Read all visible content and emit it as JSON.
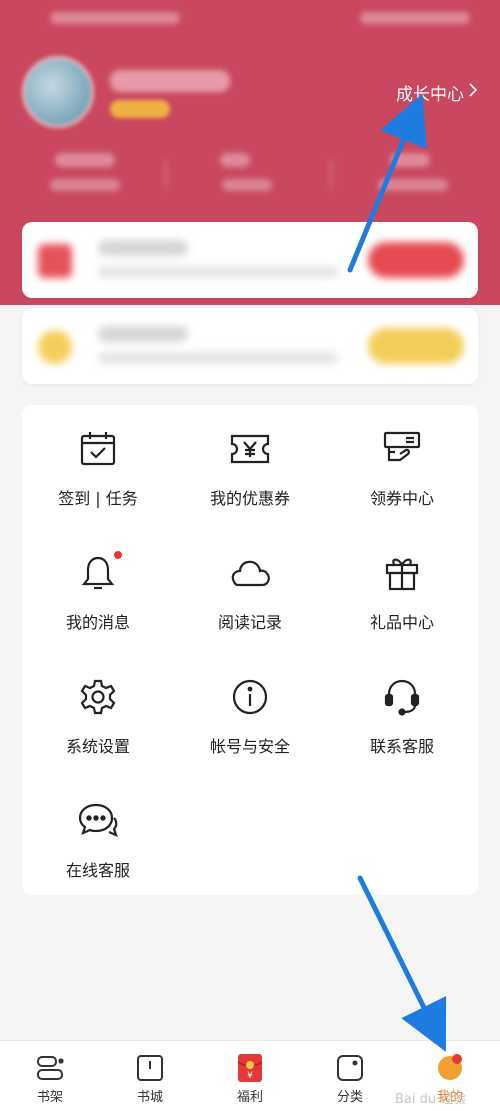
{
  "header": {
    "growth_center": "成长中心",
    "accent_color": "#c9485f"
  },
  "menu": {
    "items": [
      {
        "label": "签到 | 任务",
        "icon": "calendar-check-icon"
      },
      {
        "label": "我的优惠券",
        "icon": "yen-coupon-icon"
      },
      {
        "label": "领券中心",
        "icon": "coupon-hand-icon"
      },
      {
        "label": "我的消息",
        "icon": "bell-icon",
        "badge": true
      },
      {
        "label": "阅读记录",
        "icon": "cloud-icon"
      },
      {
        "label": "礼品中心",
        "icon": "gift-icon"
      },
      {
        "label": "系统设置",
        "icon": "gear-icon"
      },
      {
        "label": "帐号与安全",
        "icon": "info-icon"
      },
      {
        "label": "联系客服",
        "icon": "headset-icon"
      },
      {
        "label": "在线客服",
        "icon": "chat-bubbles-icon"
      }
    ]
  },
  "tabbar": {
    "tabs": [
      {
        "label": "书架",
        "icon": "bookshelf-icon"
      },
      {
        "label": "书城",
        "icon": "book-icon"
      },
      {
        "label": "福利",
        "icon": "red-envelope-icon"
      },
      {
        "label": "分类",
        "icon": "category-icon"
      },
      {
        "label": "我的",
        "icon": "profile-icon",
        "active": true
      }
    ],
    "active_color": "#e87d1e"
  },
  "watermark": "Bai du 经验",
  "annotation_color": "#1e7be0"
}
